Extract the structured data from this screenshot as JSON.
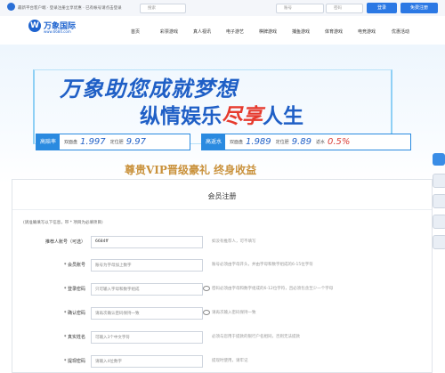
{
  "topbar": {
    "notice": "最新平台客户端 · 登录注册立享优惠 · 已有帐号请点击登录",
    "search_placeholder": "搜索",
    "account_placeholder": "账号",
    "password_placeholder": "密码",
    "login_label": "登录",
    "register_label": "免费注册"
  },
  "brand": {
    "mark": "W",
    "name": "万象国际",
    "url": "www.6684.com"
  },
  "nav": {
    "items": [
      "首页",
      "彩票游戏",
      "真人视讯",
      "电子游艺",
      "棋牌游戏",
      "捕鱼游戏",
      "体育游戏",
      "电竞游戏",
      "优惠活动"
    ]
  },
  "hero": {
    "slogan_line1": "万象助您成就梦想",
    "slogan_line2_a": "纵情娱乐",
    "slogan_line2_b": "尽享",
    "slogan_line2_c": "人生",
    "rate_left": {
      "tag": "高赔率",
      "l1": "双面盘",
      "v1": "1.997",
      "l2": "定位胆",
      "v2": "9.97"
    },
    "rate_right": {
      "tag": "高返水",
      "l1": "双面盘",
      "v1": "1.989",
      "l2": "定位胆",
      "v2": "9.89",
      "l3": "返水",
      "v3": "0.5%"
    },
    "vip_banner": "尊贵VIP晋级豪礼 终身收益"
  },
  "register": {
    "title": "会员注册",
    "note": "(请准确填写以下信息，带 * 项目为必填项目)",
    "fields": [
      {
        "label": "推荐人账号（可选）",
        "value": "6684ff",
        "hint": "如没有推荐人，可不填写"
      },
      {
        "label": "* 会员账号",
        "placeholder": "账号为字母加上数字",
        "hint": "账号必须由字母开头，并由字母和数字组成的6-15位字符"
      },
      {
        "label": "* 登录密码",
        "placeholder": "只可输入字母和数字组成",
        "hint": "密码必须由字母和数字组成的6-12位字符，且必须包含至少一个字母"
      },
      {
        "label": "* 确认密码",
        "placeholder": "请再次确认密码保持一致",
        "hint": "请再次输入密码保持一致"
      },
      {
        "label": "* 真实姓名",
        "placeholder": "可输入3个中文字符",
        "hint": "必须与您用于提款的银行户名相同，否则无法提款"
      },
      {
        "label": "* 提现密码",
        "placeholder": "请输入4位数字",
        "hint": "提现时使用，请牢记"
      }
    ]
  },
  "colors": {
    "primary": "#2b78e4",
    "accent_red": "#e63a2d",
    "gold": "#c9913b"
  },
  "side_icons": [
    "chat-icon",
    "qq-icon",
    "phone-icon",
    "app-icon",
    "top-icon"
  ]
}
